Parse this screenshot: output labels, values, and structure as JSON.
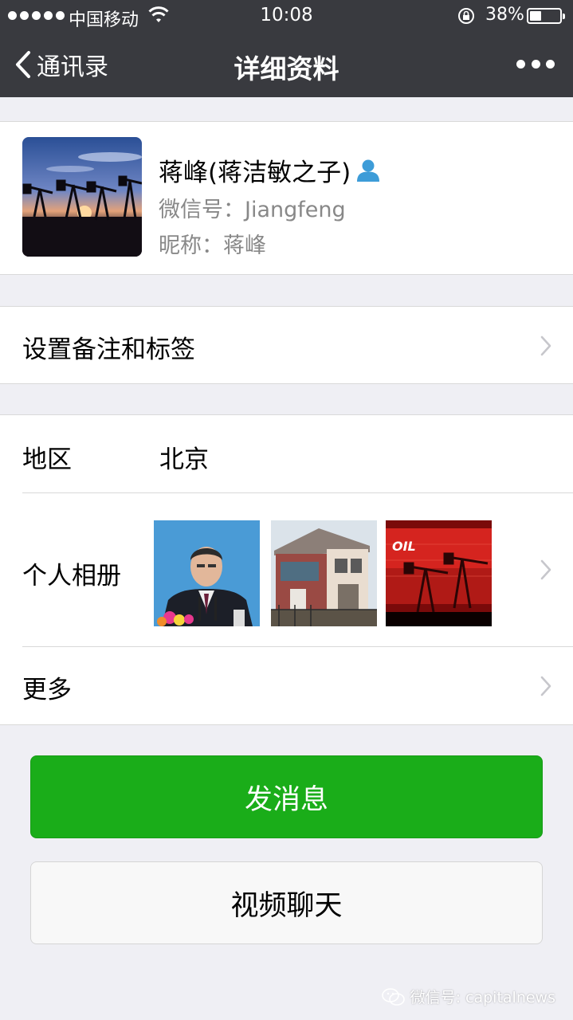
{
  "status_bar": {
    "carrier": "中国移动",
    "time": "10:08",
    "battery_percent": "38%",
    "battery_level": 0.38
  },
  "nav": {
    "back_label": "通讯录",
    "title": "详细资料"
  },
  "profile": {
    "name": "蒋峰(蒋洁敏之子)",
    "wechat_id": "微信号：Jiangfeng",
    "nickname": "昵称：蒋峰"
  },
  "rows": {
    "remark_label": "设置备注和标签",
    "region_label": "地区",
    "region_value": "北京",
    "album_label": "个人相册",
    "more_label": "更多"
  },
  "album": {
    "oil_sign_text": "OIL"
  },
  "buttons": {
    "send_message": "发消息",
    "video_chat": "视频聊天"
  },
  "watermark": "微信号: capitalnews",
  "colors": {
    "nav_bg": "#393a3f",
    "primary_green": "#1aad19",
    "page_bg": "#efeff4"
  }
}
